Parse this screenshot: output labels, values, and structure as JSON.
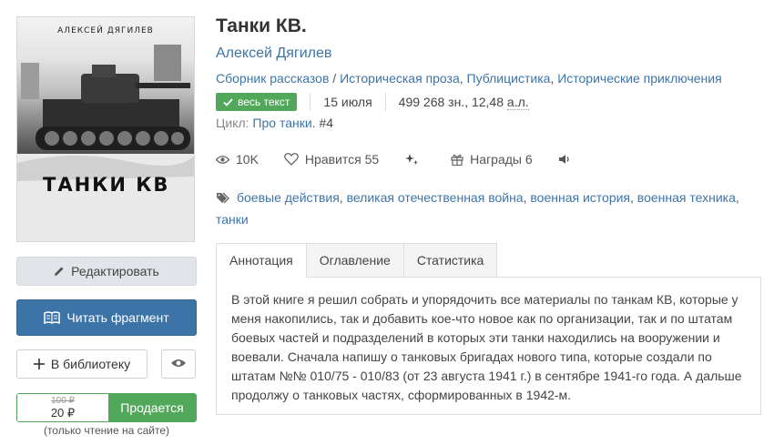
{
  "cover": {
    "author_text": "АЛЕКСЕЙ  ДЯГИЛЕВ",
    "title_text": "ТАНКИ  КВ"
  },
  "left": {
    "edit_label": "Редактировать",
    "read_label": "Читать фрагмент",
    "library_label": "В библиотеку",
    "old_price": "100 ₽",
    "new_price": "20 ₽",
    "sell_label": "Продается",
    "only_site": "(только чтение на сайте)"
  },
  "book": {
    "title": "Танки КВ.",
    "author": "Алексей Дягилев",
    "genres": [
      "Сборник рассказов",
      "Историческая проза",
      "Публицистика",
      "Исторические приключения"
    ],
    "full_text_badge": "весь текст",
    "date": "15 июля",
    "size_chars": "499 268 зн., 12,48",
    "size_al": "а.л.",
    "cycle_label": "Цикл:",
    "cycle_name": "Про танки.",
    "cycle_num": "#4"
  },
  "stats": {
    "views": "10K",
    "likes_label": "Нравится",
    "likes_count": "55",
    "awards_label": "Награды",
    "awards_count": "6"
  },
  "tags": [
    "боевые действия",
    "великая отечественная война",
    "военная история",
    "военная техника",
    "танки"
  ],
  "tabs": [
    "Аннотация",
    "Оглавление",
    "Статистика"
  ],
  "annotation": "В этой книге я решил собрать и упорядочить все материалы по танкам КВ, которые у меня накопились, так и добавить кое-что новое как по организации, так и по штатам боевых частей и подразделений в которых эти танки находились на вооружении и воевали. Сначала напишу о танковых бригадах нового типа, которые создали по штатам №№ 010/75 - 010/83 (от 23 августа 1941 г.) в сентябре 1941-го года. А дальше продолжу о танковых частях, сформированных в 1942-м.",
  "colors": {
    "link": "#3d74a8",
    "green": "#52a85a",
    "primary_button": "#3d74a8"
  }
}
